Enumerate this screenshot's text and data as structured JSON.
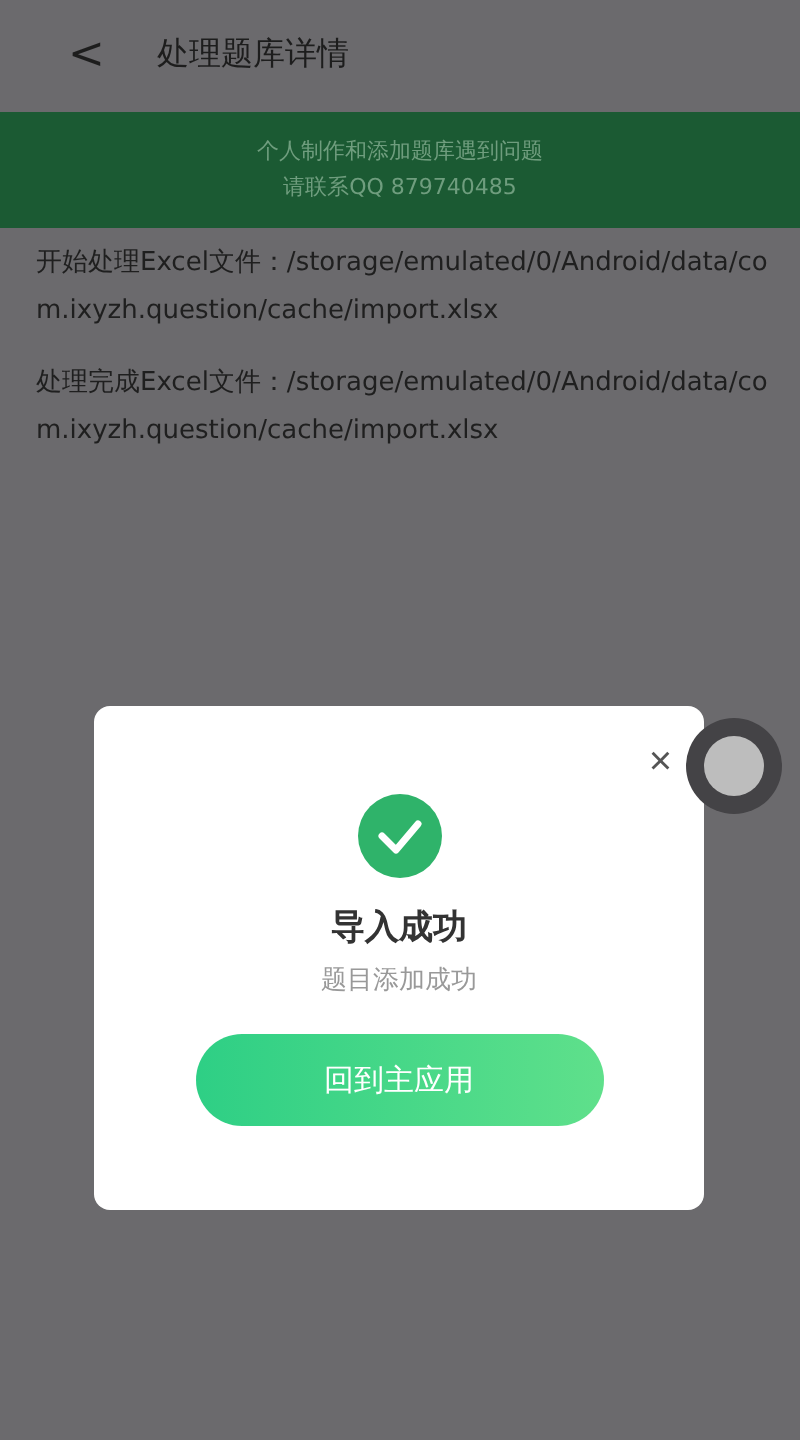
{
  "header": {
    "back": "<",
    "title": "处理题库详情"
  },
  "banner": {
    "lines": [
      "个人制作和添加题库遇到问题",
      "请联系QQ 879740485"
    ]
  },
  "log": [
    "开始处理Excel文件：/storage/emulated/0/Android/data/com.ixyzh.question/cache/import.xlsx",
    "处理完成Excel文件：/storage/emulated/0/Android/data/com.ixyzh.question/cache/import.xlsx"
  ],
  "dialog": {
    "close": "×",
    "title": "导入成功",
    "message": "题目添加成功",
    "button": "回到主应用"
  }
}
